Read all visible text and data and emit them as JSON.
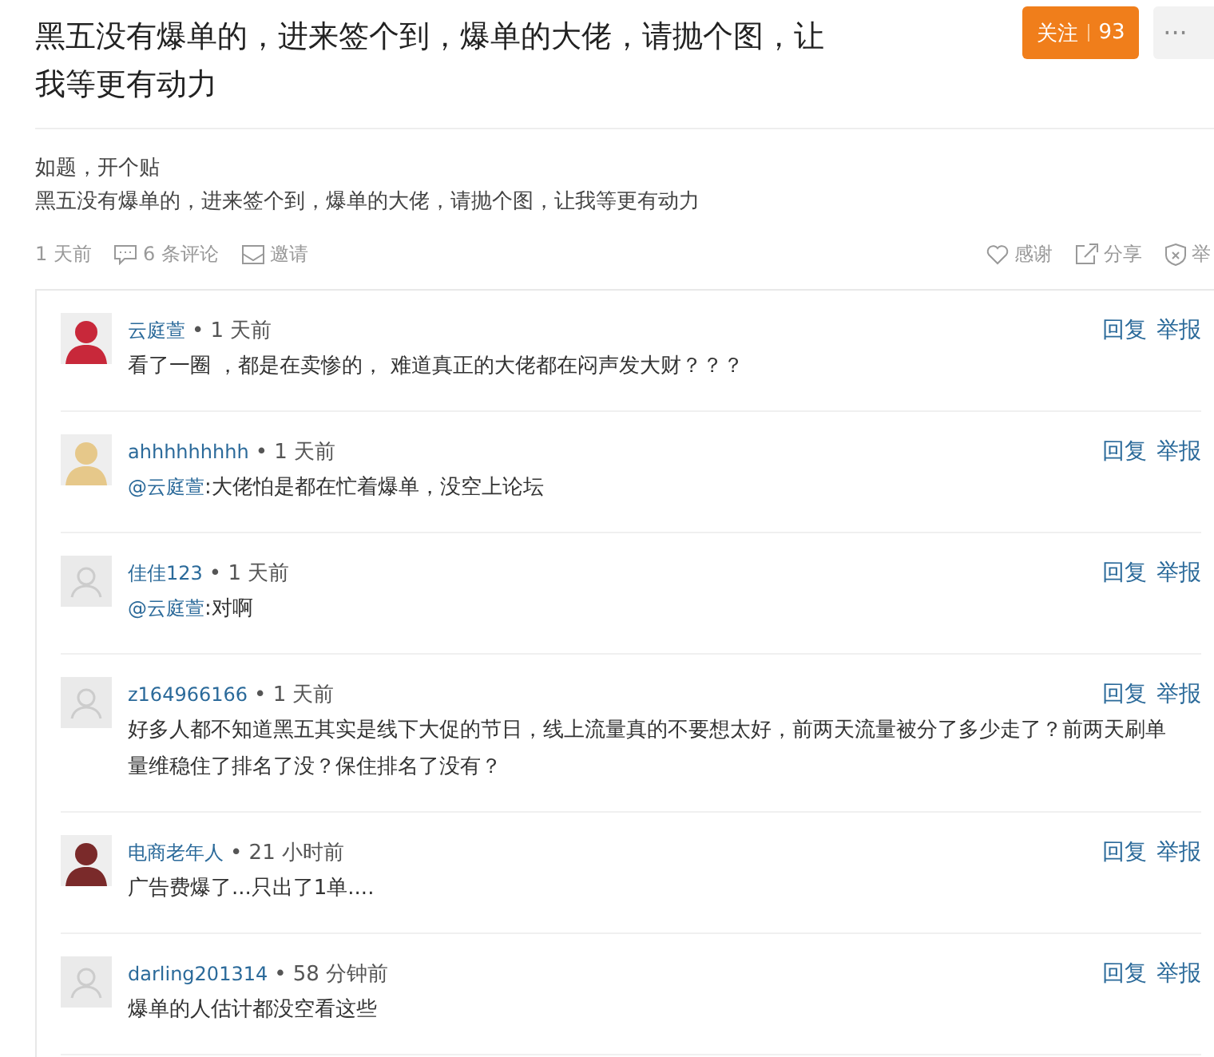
{
  "post": {
    "title": "黑五没有爆单的，进来签个到，爆单的大佬，请抛个图，让我等更有动力",
    "follow": {
      "label": "关注",
      "count": "93"
    },
    "more": "···",
    "body": [
      "如题，开个贴",
      "黑五没有爆单的，进来签个到，爆单的大佬，请抛个图，让我等更有动力"
    ],
    "meta": {
      "time": "1 天前",
      "comments": "6 条评论",
      "invite": "邀请",
      "thanks": "感谢",
      "share": "分享",
      "report": "举"
    }
  },
  "comments": [
    {
      "kind": "picture",
      "color": "#c8283a",
      "user": "云庭萱",
      "time": "• 1 天前",
      "text": "看了一圈 ，都是在卖惨的， 难道真正的大佬都在闷声发大财？？？",
      "reply": "回复",
      "report": "举报"
    },
    {
      "kind": "picture",
      "color": "#e6c88a",
      "user": "ahhhhhhhhh",
      "time": "• 1 天前",
      "mention": "@云庭萱",
      "text": ":大佬怕是都在忙着爆单，没空上论坛",
      "reply": "回复",
      "report": "举报"
    },
    {
      "kind": "placeholder",
      "user": "佳佳123",
      "time": "• 1 天前",
      "mention": "@云庭萱",
      "text": ":对啊",
      "reply": "回复",
      "report": "举报"
    },
    {
      "kind": "placeholder",
      "user": "z164966166",
      "time": "• 1 天前",
      "text": "好多人都不知道黑五其实是线下大促的节日，线上流量真的不要想太好，前两天流量被分了多少走了？前两天刷单量维稳住了排名了没？保住排名了没有？",
      "reply": "回复",
      "report": "举报"
    },
    {
      "kind": "picture",
      "color": "#7a2a2a",
      "user": "电商老年人",
      "time": "• 21 小时前",
      "text": "广告费爆了...只出了1单....",
      "reply": "回复",
      "report": "举报"
    },
    {
      "kind": "placeholder",
      "user": "darling201314",
      "time": "• 58 分钟前",
      "text": "爆单的人估计都没空看这些",
      "reply": "回复",
      "report": "举报"
    }
  ]
}
